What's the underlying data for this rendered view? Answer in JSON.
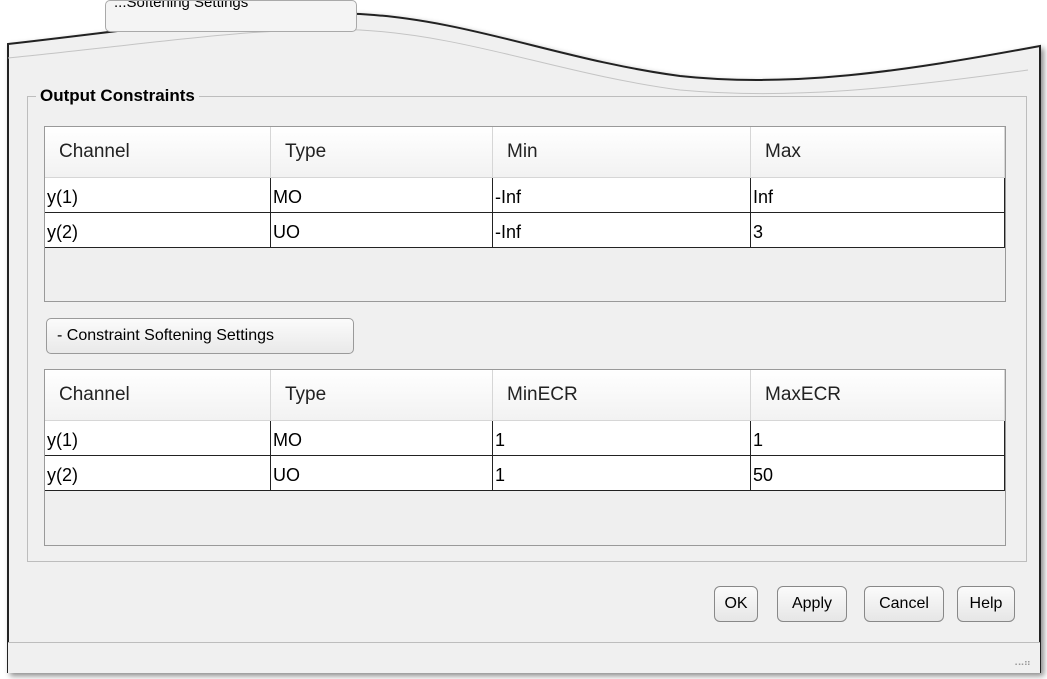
{
  "top_partial_button": {
    "label": "...Softening Settings"
  },
  "output_constraints": {
    "title": "Output Constraints",
    "columns": [
      "Channel",
      "Type",
      "Min",
      "Max"
    ],
    "rows": [
      [
        "y(1)",
        "MO",
        "-Inf",
        "Inf"
      ],
      [
        "y(2)",
        "UO",
        "-Inf",
        "3"
      ]
    ]
  },
  "softening_toggle": {
    "label": "- Constraint Softening Settings"
  },
  "softening_table": {
    "columns": [
      "Channel",
      "Type",
      "MinECR",
      "MaxECR"
    ],
    "rows": [
      [
        "y(1)",
        "MO",
        "1",
        "1"
      ],
      [
        "y(2)",
        "UO",
        "1",
        "50"
      ]
    ]
  },
  "buttons": {
    "ok": "OK",
    "apply": "Apply",
    "cancel": "Cancel",
    "help": "Help"
  }
}
